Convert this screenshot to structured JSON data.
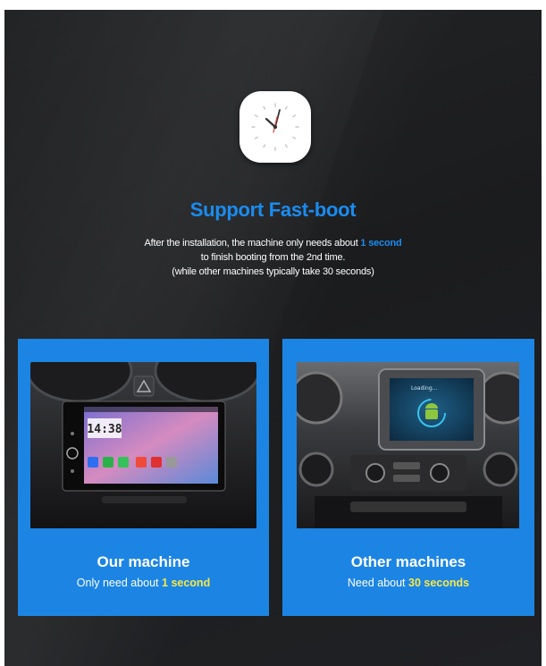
{
  "header": {
    "icon": "clock-icon",
    "title": "Support Fast-boot",
    "line1_pre": "After the installation, the machine only needs about ",
    "line1_highlight": "1 second",
    "line2": "to finish booting from the 2nd time.",
    "line3": "(while other machines typically take 30 seconds)"
  },
  "cards": [
    {
      "title": "Our machine",
      "sub_pre": "Only need about ",
      "sub_highlight": "1 second",
      "screen_time": "14:38"
    },
    {
      "title": "Other machines",
      "sub_pre": "Need about ",
      "sub_highlight": "30 seconds",
      "screen_text": "Loading..."
    }
  ],
  "colors": {
    "accent_blue": "#1a8cf0",
    "card_blue": "#1c85e4",
    "highlight_yellow": "#f7e74a",
    "background": "#1e1f21"
  }
}
